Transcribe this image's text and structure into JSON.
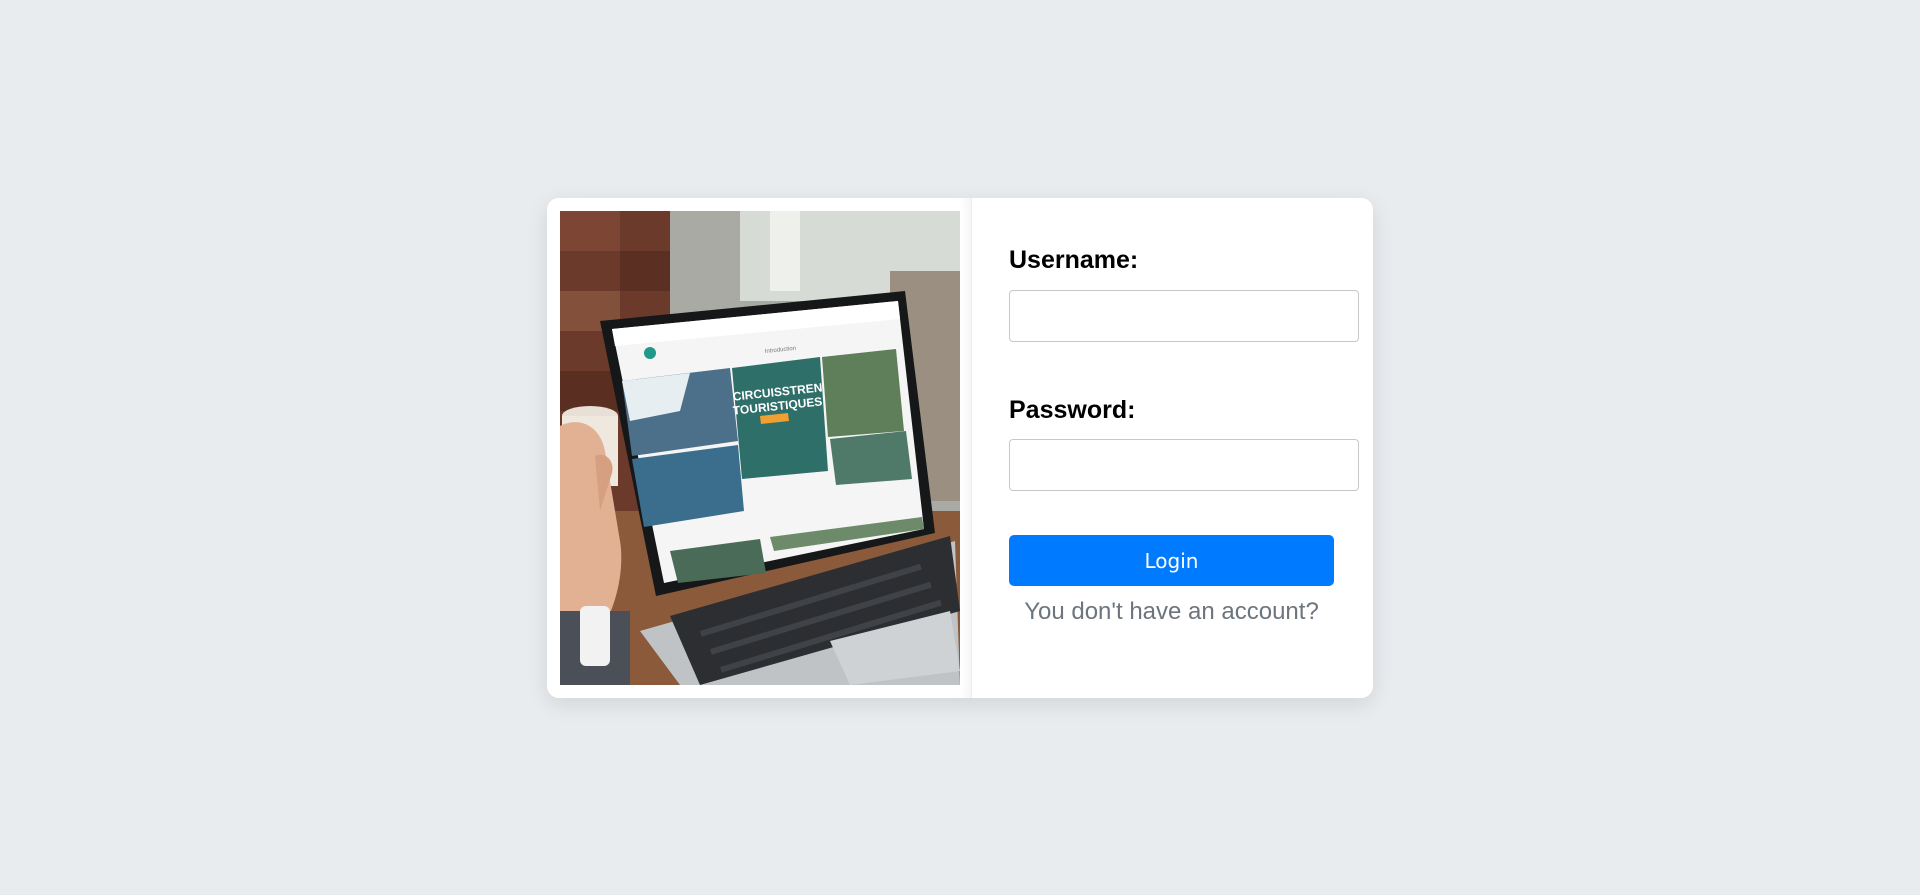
{
  "login": {
    "username_label": "Username:",
    "username_value": "",
    "username_placeholder": "",
    "password_label": "Password:",
    "password_value": "",
    "password_placeholder": "",
    "login_button": "Login",
    "signup_link": "You don't have an account?"
  },
  "photo": {
    "screen_headline_1": "CIRCUISSTREN",
    "screen_headline_2": "TOURISTIQUES",
    "screen_subtitle": "Introduction",
    "icon": "laptop-photo"
  },
  "colors": {
    "page_background": "#e8ecef",
    "card_background": "#ffffff",
    "button_primary": "#007bff",
    "link_muted": "#6c757d"
  }
}
